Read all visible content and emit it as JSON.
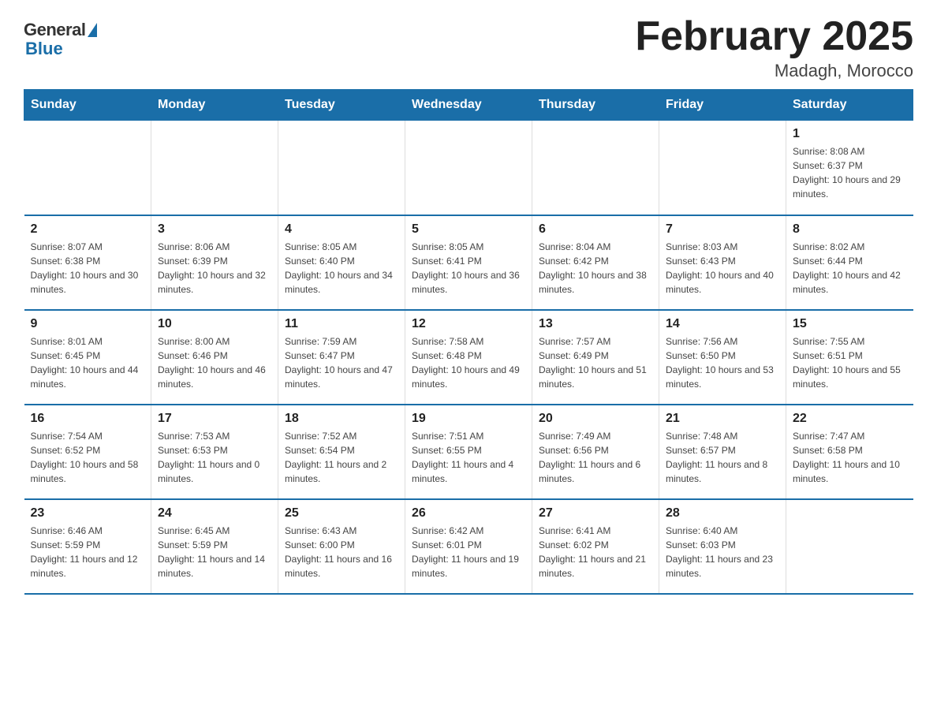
{
  "logo": {
    "general": "General",
    "blue": "Blue"
  },
  "header": {
    "title": "February 2025",
    "location": "Madagh, Morocco"
  },
  "days_of_week": [
    "Sunday",
    "Monday",
    "Tuesday",
    "Wednesday",
    "Thursday",
    "Friday",
    "Saturday"
  ],
  "weeks": [
    [
      {
        "day": "",
        "info": ""
      },
      {
        "day": "",
        "info": ""
      },
      {
        "day": "",
        "info": ""
      },
      {
        "day": "",
        "info": ""
      },
      {
        "day": "",
        "info": ""
      },
      {
        "day": "",
        "info": ""
      },
      {
        "day": "1",
        "info": "Sunrise: 8:08 AM\nSunset: 6:37 PM\nDaylight: 10 hours and 29 minutes."
      }
    ],
    [
      {
        "day": "2",
        "info": "Sunrise: 8:07 AM\nSunset: 6:38 PM\nDaylight: 10 hours and 30 minutes."
      },
      {
        "day": "3",
        "info": "Sunrise: 8:06 AM\nSunset: 6:39 PM\nDaylight: 10 hours and 32 minutes."
      },
      {
        "day": "4",
        "info": "Sunrise: 8:05 AM\nSunset: 6:40 PM\nDaylight: 10 hours and 34 minutes."
      },
      {
        "day": "5",
        "info": "Sunrise: 8:05 AM\nSunset: 6:41 PM\nDaylight: 10 hours and 36 minutes."
      },
      {
        "day": "6",
        "info": "Sunrise: 8:04 AM\nSunset: 6:42 PM\nDaylight: 10 hours and 38 minutes."
      },
      {
        "day": "7",
        "info": "Sunrise: 8:03 AM\nSunset: 6:43 PM\nDaylight: 10 hours and 40 minutes."
      },
      {
        "day": "8",
        "info": "Sunrise: 8:02 AM\nSunset: 6:44 PM\nDaylight: 10 hours and 42 minutes."
      }
    ],
    [
      {
        "day": "9",
        "info": "Sunrise: 8:01 AM\nSunset: 6:45 PM\nDaylight: 10 hours and 44 minutes."
      },
      {
        "day": "10",
        "info": "Sunrise: 8:00 AM\nSunset: 6:46 PM\nDaylight: 10 hours and 46 minutes."
      },
      {
        "day": "11",
        "info": "Sunrise: 7:59 AM\nSunset: 6:47 PM\nDaylight: 10 hours and 47 minutes."
      },
      {
        "day": "12",
        "info": "Sunrise: 7:58 AM\nSunset: 6:48 PM\nDaylight: 10 hours and 49 minutes."
      },
      {
        "day": "13",
        "info": "Sunrise: 7:57 AM\nSunset: 6:49 PM\nDaylight: 10 hours and 51 minutes."
      },
      {
        "day": "14",
        "info": "Sunrise: 7:56 AM\nSunset: 6:50 PM\nDaylight: 10 hours and 53 minutes."
      },
      {
        "day": "15",
        "info": "Sunrise: 7:55 AM\nSunset: 6:51 PM\nDaylight: 10 hours and 55 minutes."
      }
    ],
    [
      {
        "day": "16",
        "info": "Sunrise: 7:54 AM\nSunset: 6:52 PM\nDaylight: 10 hours and 58 minutes."
      },
      {
        "day": "17",
        "info": "Sunrise: 7:53 AM\nSunset: 6:53 PM\nDaylight: 11 hours and 0 minutes."
      },
      {
        "day": "18",
        "info": "Sunrise: 7:52 AM\nSunset: 6:54 PM\nDaylight: 11 hours and 2 minutes."
      },
      {
        "day": "19",
        "info": "Sunrise: 7:51 AM\nSunset: 6:55 PM\nDaylight: 11 hours and 4 minutes."
      },
      {
        "day": "20",
        "info": "Sunrise: 7:49 AM\nSunset: 6:56 PM\nDaylight: 11 hours and 6 minutes."
      },
      {
        "day": "21",
        "info": "Sunrise: 7:48 AM\nSunset: 6:57 PM\nDaylight: 11 hours and 8 minutes."
      },
      {
        "day": "22",
        "info": "Sunrise: 7:47 AM\nSunset: 6:58 PM\nDaylight: 11 hours and 10 minutes."
      }
    ],
    [
      {
        "day": "23",
        "info": "Sunrise: 6:46 AM\nSunset: 5:59 PM\nDaylight: 11 hours and 12 minutes."
      },
      {
        "day": "24",
        "info": "Sunrise: 6:45 AM\nSunset: 5:59 PM\nDaylight: 11 hours and 14 minutes."
      },
      {
        "day": "25",
        "info": "Sunrise: 6:43 AM\nSunset: 6:00 PM\nDaylight: 11 hours and 16 minutes."
      },
      {
        "day": "26",
        "info": "Sunrise: 6:42 AM\nSunset: 6:01 PM\nDaylight: 11 hours and 19 minutes."
      },
      {
        "day": "27",
        "info": "Sunrise: 6:41 AM\nSunset: 6:02 PM\nDaylight: 11 hours and 21 minutes."
      },
      {
        "day": "28",
        "info": "Sunrise: 6:40 AM\nSunset: 6:03 PM\nDaylight: 11 hours and 23 minutes."
      },
      {
        "day": "",
        "info": ""
      }
    ]
  ]
}
